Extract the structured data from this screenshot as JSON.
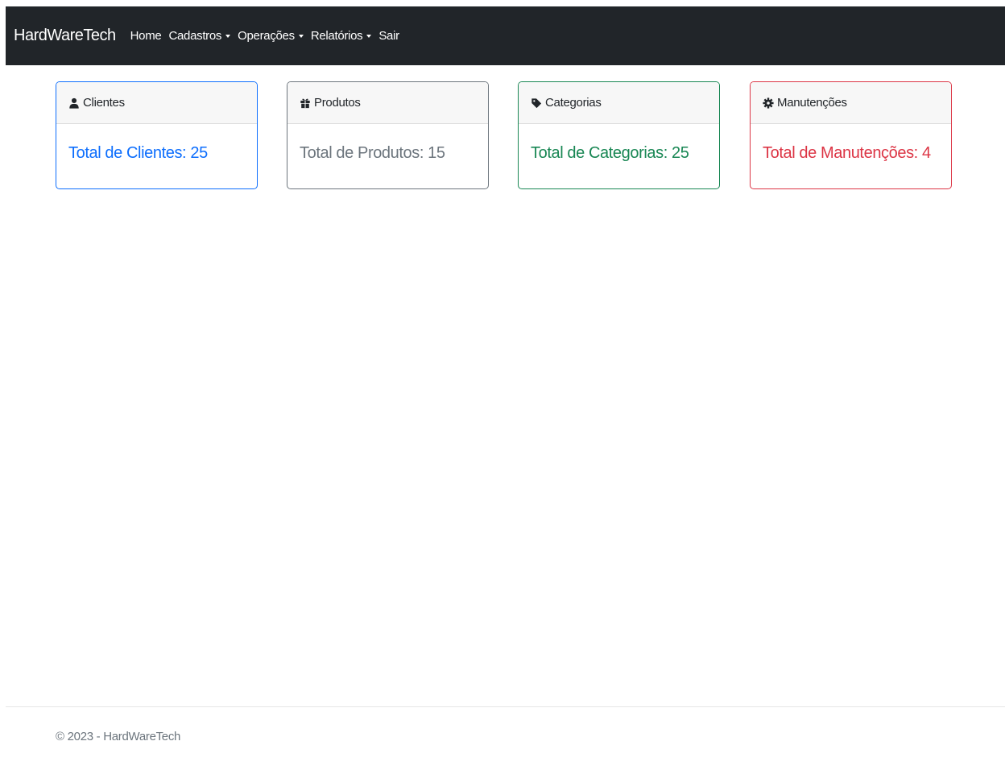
{
  "navbar": {
    "brand": "HardWareTech",
    "items": [
      {
        "label": "Home",
        "dropdown": false
      },
      {
        "label": "Cadastros",
        "dropdown": true
      },
      {
        "label": "Operações",
        "dropdown": true
      },
      {
        "label": "Relatórios",
        "dropdown": true
      },
      {
        "label": "Sair",
        "dropdown": false
      }
    ],
    "background": "#212529"
  },
  "cards": [
    {
      "title": "Clientes",
      "icon": "user-icon",
      "body": "Total de Clientes: 25",
      "color": "#0d6efd"
    },
    {
      "title": "Produtos",
      "icon": "gift-icon",
      "body": "Total de Produtos: 15",
      "color": "#6c757d"
    },
    {
      "title": "Categorias",
      "icon": "tag-icon",
      "body": "Total de Categorias: 25",
      "color": "#198754"
    },
    {
      "title": "Manutenções",
      "icon": "gear-icon",
      "body": "Total de Manutenções: 4",
      "color": "#dc3545"
    }
  ],
  "footer": {
    "text": "© 2023 - HardWareTech"
  }
}
